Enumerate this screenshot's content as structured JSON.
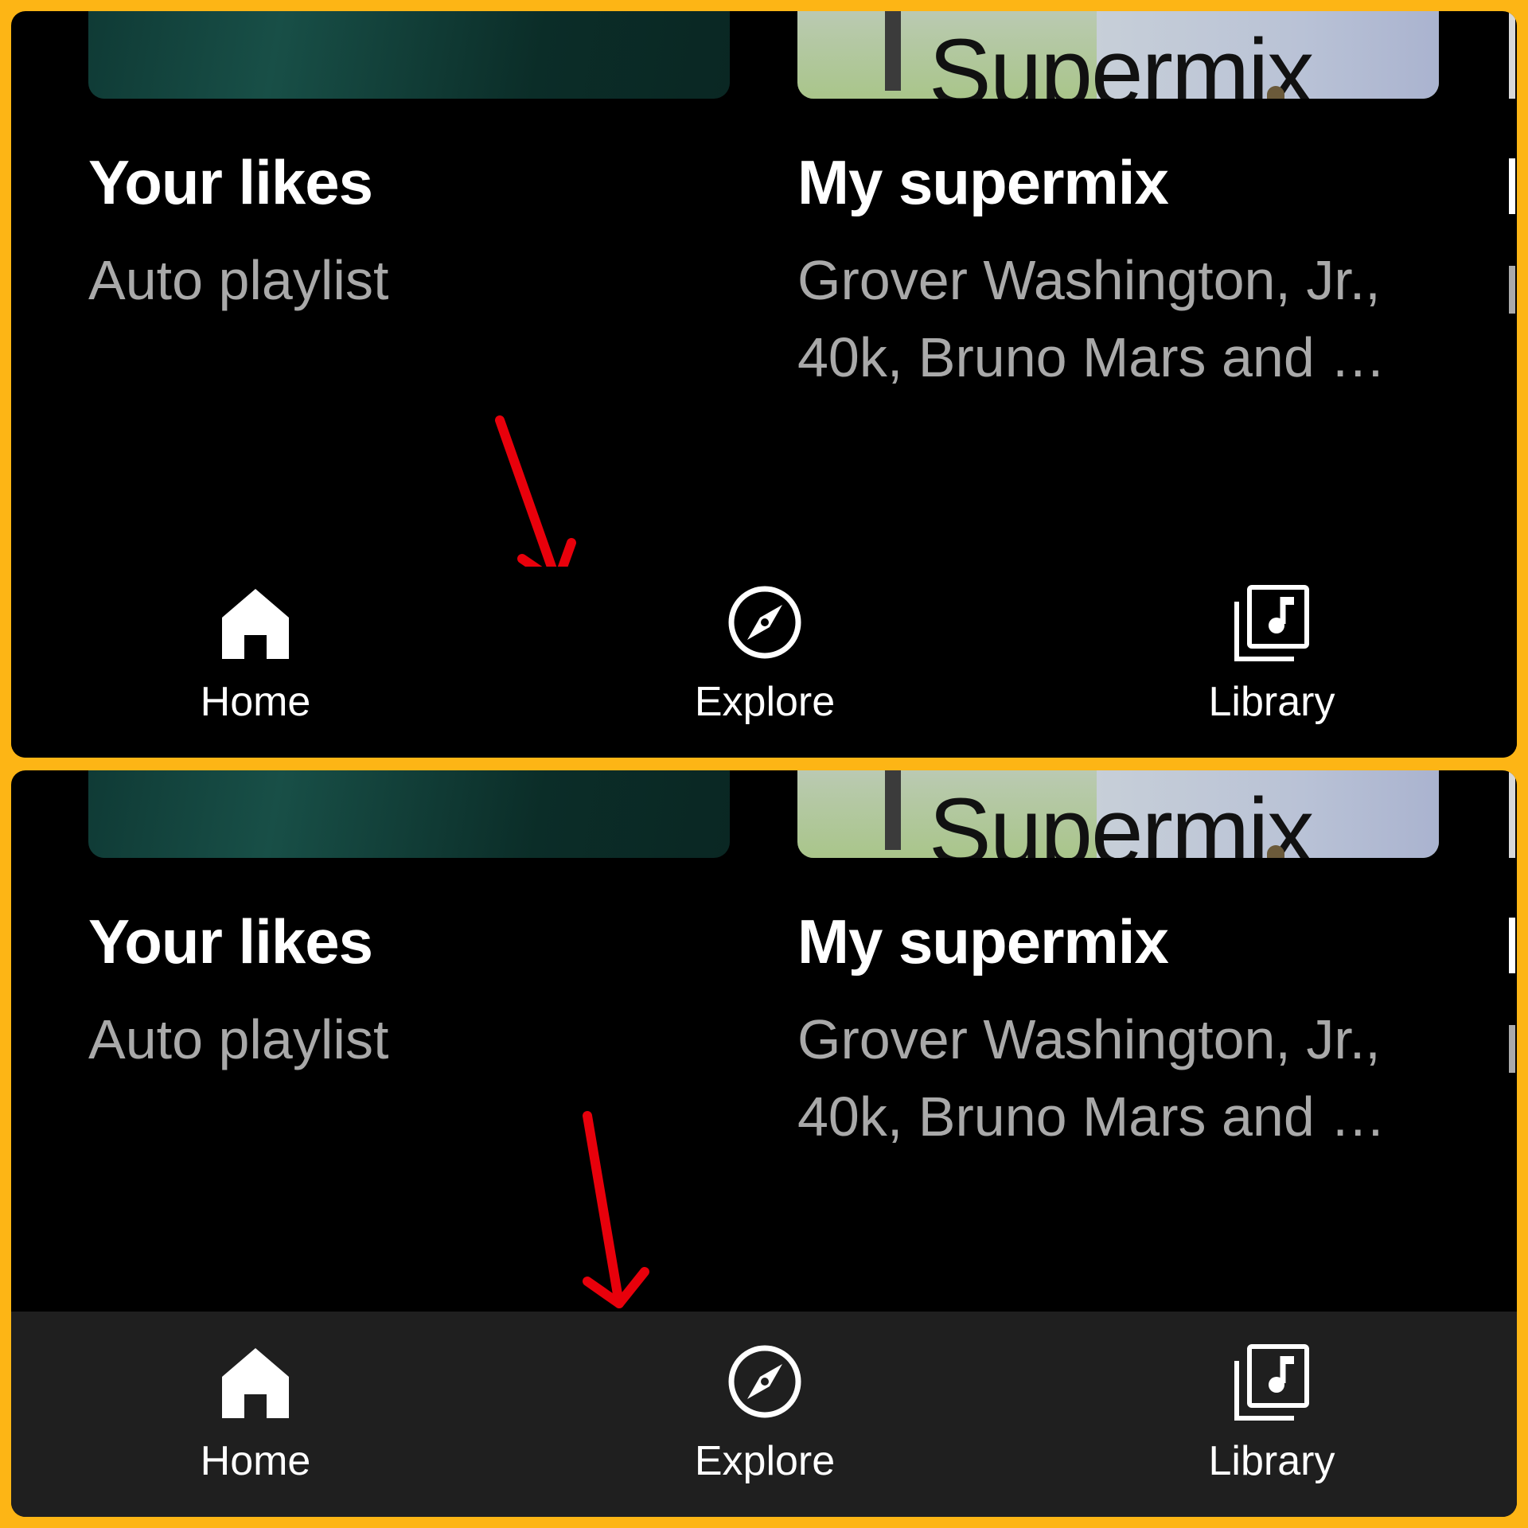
{
  "panels": [
    {
      "cards": [
        {
          "title": "Your likes",
          "subtitle_lines": [
            "Auto playlist"
          ],
          "art": "gradient-teal"
        },
        {
          "title": "My supermix",
          "subtitle_lines": [
            "Grover Washington, Jr.,",
            "40k, Bruno Mars and …"
          ],
          "art_text": "Supermix"
        }
      ],
      "nav": [
        {
          "label": "Home",
          "icon": "home-icon"
        },
        {
          "label": "Explore",
          "icon": "compass-icon"
        },
        {
          "label": "Library",
          "icon": "library-music-icon"
        }
      ]
    },
    {
      "cards": [
        {
          "title": "Your likes",
          "subtitle_lines": [
            "Auto playlist"
          ],
          "art": "gradient-teal"
        },
        {
          "title": "My supermix",
          "subtitle_lines": [
            "Grover Washington, Jr.,",
            "40k, Bruno Mars and …"
          ],
          "art_text": "Supermix"
        }
      ],
      "nav": [
        {
          "label": "Home",
          "icon": "home-icon"
        },
        {
          "label": "Explore",
          "icon": "compass-icon"
        },
        {
          "label": "Library",
          "icon": "library-music-icon"
        }
      ]
    }
  ],
  "colors": {
    "frame": "#FDB515",
    "background": "#000000",
    "bottom_nav_bottom_panel": "#1F1F1F",
    "annotation_arrow": "#E8000B"
  }
}
